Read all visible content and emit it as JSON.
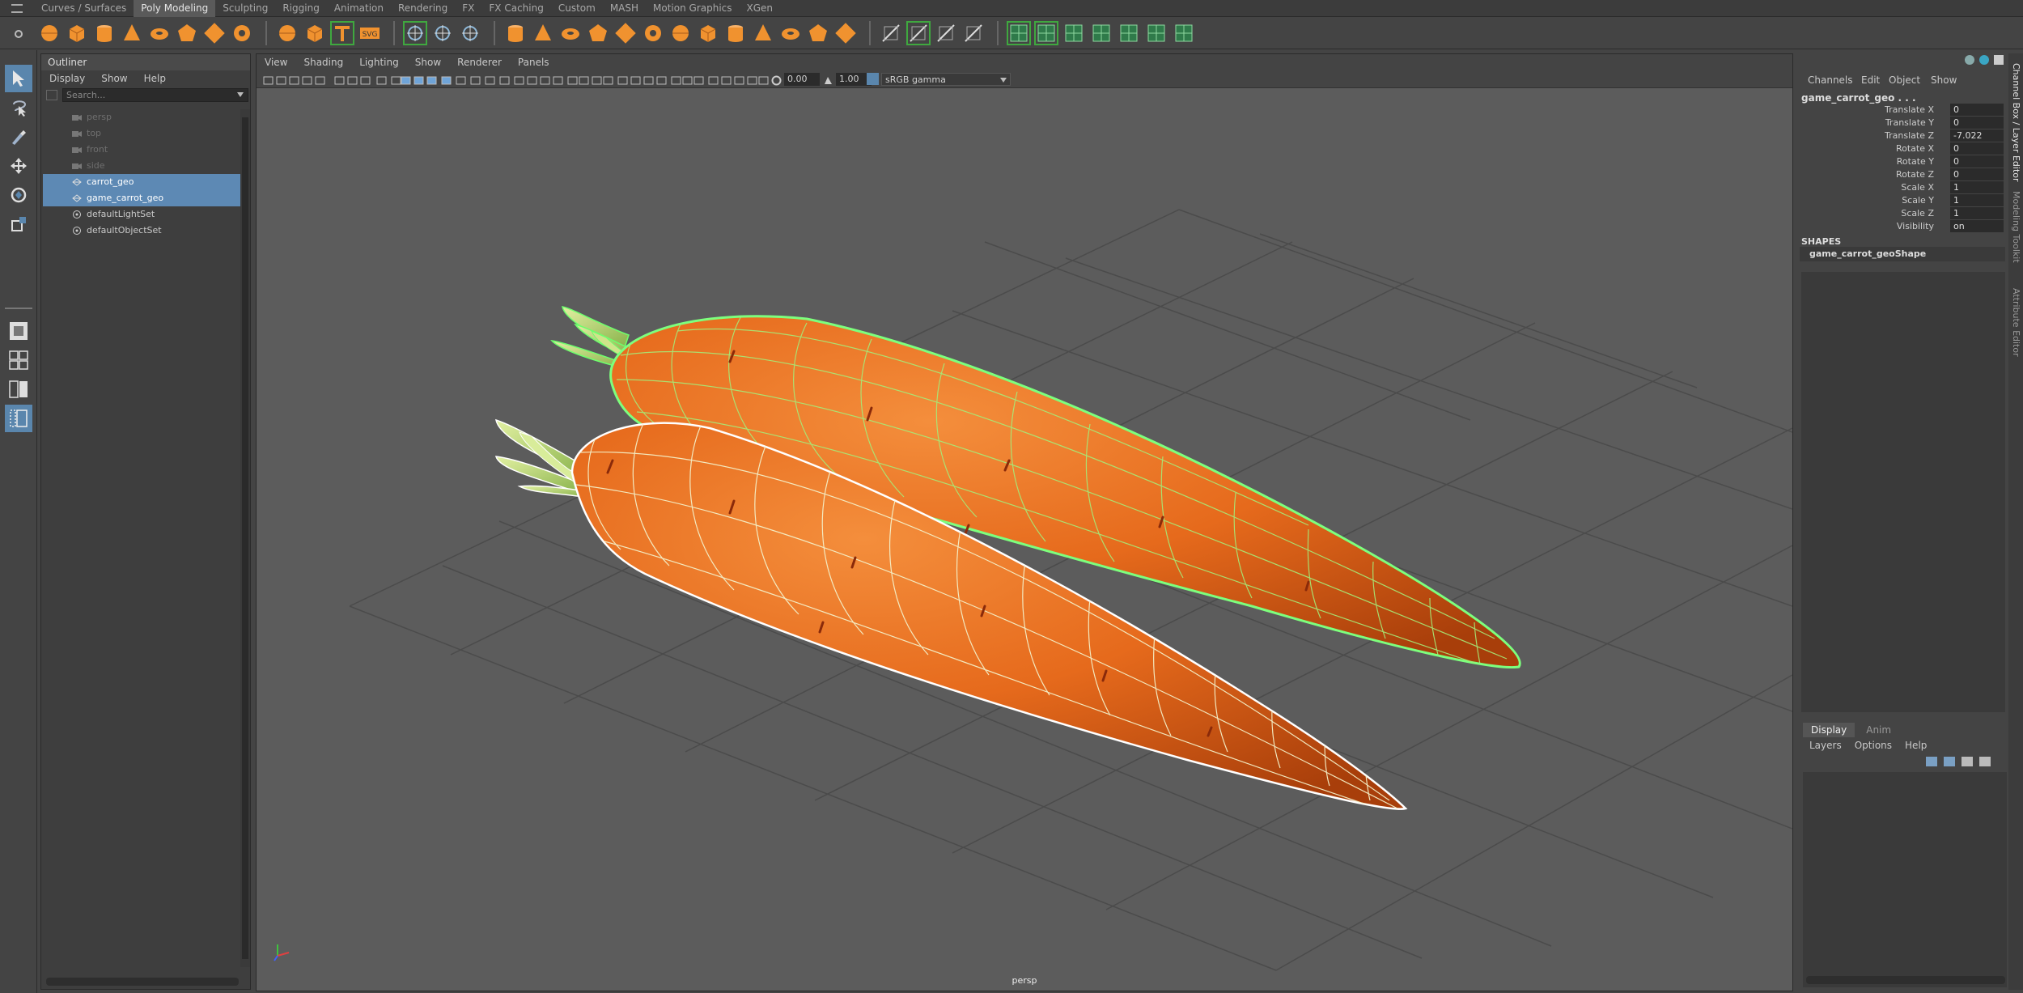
{
  "shelf": {
    "tabs": [
      {
        "label": "Curves / Surfaces"
      },
      {
        "label": "Poly Modeling",
        "active": true
      },
      {
        "label": "Sculpting"
      },
      {
        "label": "Rigging"
      },
      {
        "label": "Animation"
      },
      {
        "label": "Rendering"
      },
      {
        "label": "FX"
      },
      {
        "label": "FX Caching"
      },
      {
        "label": "Custom"
      },
      {
        "label": "MASH"
      },
      {
        "label": "Motion Graphics"
      },
      {
        "label": "XGen"
      }
    ],
    "icons": [
      "poly-sphere-icon",
      "poly-cube-icon",
      "poly-cylinder-icon",
      "poly-cone-icon",
      "poly-torus-icon",
      "poly-platonic-icon",
      "poly-disc-icon",
      "poly-pipe-icon",
      "separator",
      "super-shape-icon",
      "make-live-icon",
      "type-tool-icon",
      "svg-tool-icon",
      "separator",
      "quad-draw-icon",
      "multi-cut-icon",
      "target-weld-icon",
      "separator",
      "combine-icon",
      "separate-icon",
      "mirror-icon",
      "smooth-icon",
      "boolean-icon",
      "extrude-icon",
      "bridge-icon",
      "bevel-icon",
      "append-icon",
      "fill-hole-icon",
      "merge-icon",
      "circularize-icon",
      "connect-icon",
      "separator",
      "slide-edge-icon",
      "insert-edge-loop-icon",
      "offset-loop-icon",
      "crease-icon",
      "separator",
      "uv-planar-icon",
      "uv-cylindrical-icon",
      "uv-spherical-icon",
      "uv-auto-icon",
      "uv-editor-icon",
      "uv-layout-icon",
      "uv-toggle-icon"
    ],
    "accent": "#f0922f",
    "selected_outline": "#3fa83f"
  },
  "toolbox": {
    "tools": [
      "select-tool-icon",
      "lasso-tool-icon",
      "paint-select-icon",
      "move-tool-icon",
      "rotate-tool-icon",
      "scale-tool-icon"
    ],
    "layouts": [
      "single-perspective-icon",
      "four-view-icon",
      "two-view-icon",
      "outliner-persp-icon"
    ]
  },
  "outliner": {
    "title": "Outliner",
    "menu": [
      "Display",
      "Show",
      "Help"
    ],
    "search_placeholder": "Search...",
    "items": [
      {
        "label": "persp",
        "type": "camera",
        "state": "dim"
      },
      {
        "label": "top",
        "type": "camera",
        "state": "dim"
      },
      {
        "label": "front",
        "type": "camera",
        "state": "dim"
      },
      {
        "label": "side",
        "type": "camera",
        "state": "dim"
      },
      {
        "label": "carrot_geo",
        "type": "mesh",
        "state": "selected"
      },
      {
        "label": "game_carrot_geo",
        "type": "mesh",
        "state": "selected"
      },
      {
        "label": "defaultLightSet",
        "type": "set",
        "state": "normal"
      },
      {
        "label": "defaultObjectSet",
        "type": "set",
        "state": "normal"
      }
    ]
  },
  "viewport": {
    "menu": [
      "View",
      "Shading",
      "Lighting",
      "Show",
      "Renderer",
      "Panels"
    ],
    "exposure": "0.00",
    "gamma": "1.00",
    "color_space": "sRGB gamma",
    "camera": "persp",
    "colors": {
      "background": "#5c5c5c",
      "grid": "#434343",
      "carrot": "#e8661a",
      "wire_selected": "#7dff7d",
      "wire_white": "#ffffff"
    }
  },
  "channel_box": {
    "menu": [
      "Channels",
      "Edit",
      "Object",
      "Show"
    ],
    "object": "game_carrot_geo . . .",
    "attributes": [
      {
        "name": "Translate X",
        "value": "0"
      },
      {
        "name": "Translate Y",
        "value": "0"
      },
      {
        "name": "Translate Z",
        "value": "-7.022"
      },
      {
        "name": "Rotate X",
        "value": "0"
      },
      {
        "name": "Rotate Y",
        "value": "0"
      },
      {
        "name": "Rotate Z",
        "value": "0"
      },
      {
        "name": "Scale X",
        "value": "1"
      },
      {
        "name": "Scale Y",
        "value": "1"
      },
      {
        "name": "Scale Z",
        "value": "1"
      },
      {
        "name": "Visibility",
        "value": "on"
      }
    ],
    "shapes_header": "SHAPES",
    "shape_name": "game_carrot_geoShape"
  },
  "layer_editor": {
    "tabs": [
      {
        "label": "Display",
        "active": true
      },
      {
        "label": "Anim"
      }
    ],
    "menu": [
      "Layers",
      "Options",
      "Help"
    ]
  },
  "side_tabs": [
    "Channel Box / Layer Editor",
    "Modeling Toolkit",
    "Attribute Editor"
  ]
}
